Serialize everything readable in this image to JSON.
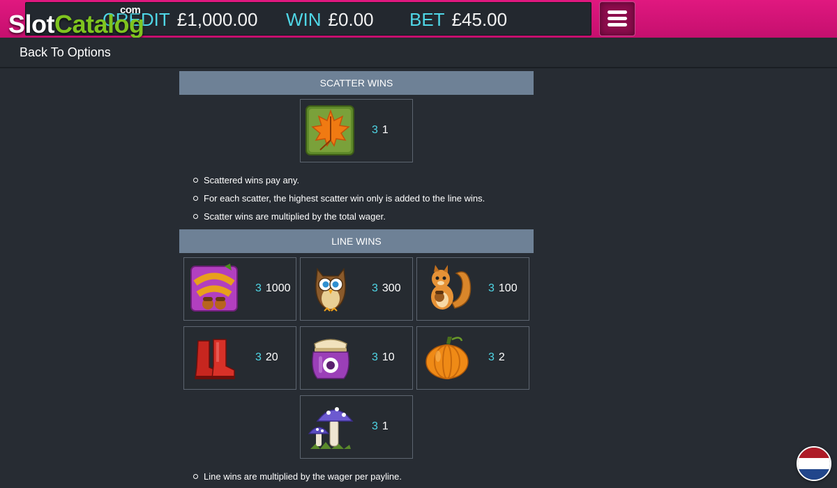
{
  "topbar": {
    "credit_label": "CREDIT",
    "credit_value": "£1,000.00",
    "win_label": "WIN",
    "win_value": "£0.00",
    "bet_label": "BET",
    "bet_value": "£45.00",
    "menu_icon": "hamburger-icon"
  },
  "watermark": {
    "part1": "Slot",
    "part2": "Catalog",
    "suffix": "com"
  },
  "nav": {
    "back_label": "Back To Options"
  },
  "scatter": {
    "title": "SCATTER WINS",
    "symbols": [
      {
        "name": "maple-leaf",
        "count": "3",
        "payout": "1"
      }
    ],
    "rules": [
      "Scattered wins pay any.",
      "For each scatter, the highest scatter win only is added to the line wins.",
      "Scatter wins are multiplied by the total wager."
    ]
  },
  "line": {
    "title": "LINE WINS",
    "symbols": [
      {
        "name": "autumn-gold-logo",
        "count": "3",
        "payout": "1000"
      },
      {
        "name": "owl",
        "count": "3",
        "payout": "300"
      },
      {
        "name": "squirrel",
        "count": "3",
        "payout": "100"
      },
      {
        "name": "red-boots",
        "count": "3",
        "payout": "20"
      },
      {
        "name": "jam-jar",
        "count": "3",
        "payout": "10"
      },
      {
        "name": "pumpkin",
        "count": "3",
        "payout": "2"
      },
      {
        "name": "mushroom",
        "count": "3",
        "payout": "1"
      }
    ],
    "rules": [
      "Line wins are multiplied by the wager per payline."
    ]
  },
  "flag": {
    "icon": "netherlands-flag-icon",
    "colors": [
      "#ae1c28",
      "#ffffff",
      "#21468b"
    ]
  },
  "colors": {
    "brand": "#d4137a",
    "accent": "#4fd6e6",
    "section_header": "#6e8196",
    "background": "#272c33"
  }
}
